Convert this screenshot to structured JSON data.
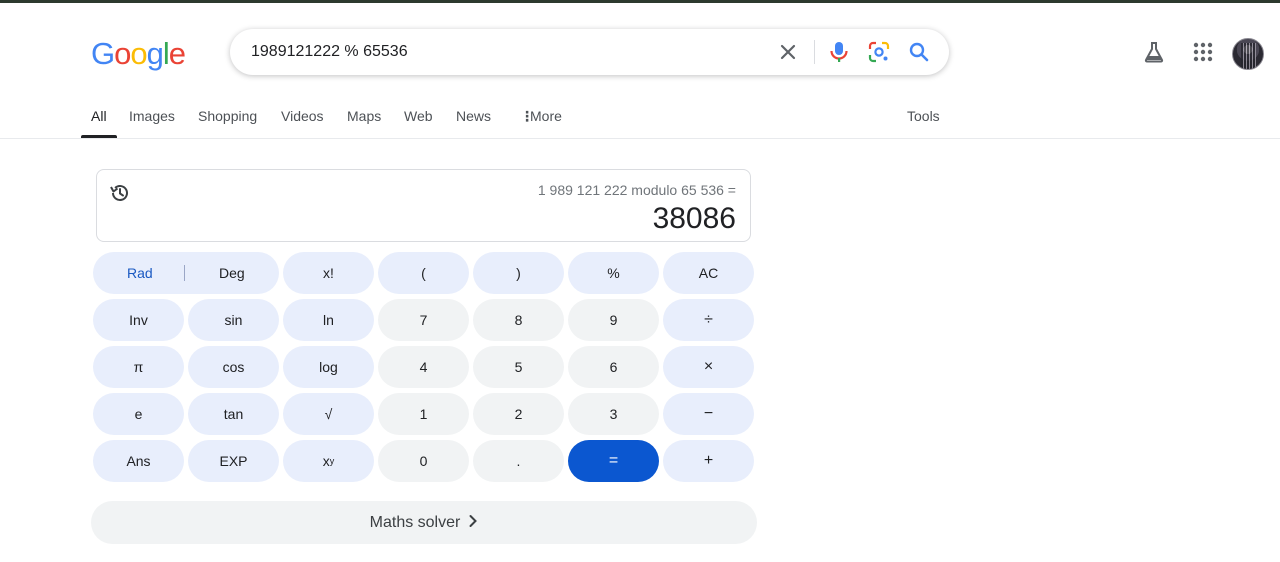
{
  "search": {
    "query": "1989121222 % 65536"
  },
  "logo": {
    "letters": [
      "G",
      "o",
      "o",
      "g",
      "l",
      "e"
    ],
    "colors": [
      "#4285f4",
      "#ea4335",
      "#fbbc05",
      "#4285f4",
      "#34a853",
      "#ea4335"
    ]
  },
  "header_icons": [
    "clear-icon",
    "mic-icon",
    "lens-icon",
    "search-icon",
    "labs-flask-icon",
    "apps-grid-icon",
    "avatar"
  ],
  "tabs": [
    {
      "label": "All"
    },
    {
      "label": "Images"
    },
    {
      "label": "Shopping"
    },
    {
      "label": "Videos"
    },
    {
      "label": "Maps"
    },
    {
      "label": "Web"
    },
    {
      "label": "News"
    },
    {
      "label": "More"
    }
  ],
  "tools_label": "Tools",
  "calculator": {
    "expression": "1 989 121 222 modulo 65 536 =",
    "result": "38086",
    "rad": "Rad",
    "deg": "Deg",
    "keys": [
      [
        "x!",
        "(",
        ")",
        "%",
        "AC"
      ],
      [
        "Inv",
        "sin",
        "ln",
        "7",
        "8",
        "9",
        "÷"
      ],
      [
        "π",
        "cos",
        "log",
        "4",
        "5",
        "6",
        "×"
      ],
      [
        "e",
        "tan",
        "√",
        "1",
        "2",
        "3",
        "−"
      ],
      [
        "Ans",
        "EXP",
        "x",
        "0",
        ".",
        "=",
        "+"
      ]
    ],
    "xy_sup": "y"
  },
  "solver_label": "Maths solver",
  "colors": {
    "accent": "#0b57d0",
    "fn_key": "#e8eefc",
    "num_key": "#f1f3f4"
  }
}
